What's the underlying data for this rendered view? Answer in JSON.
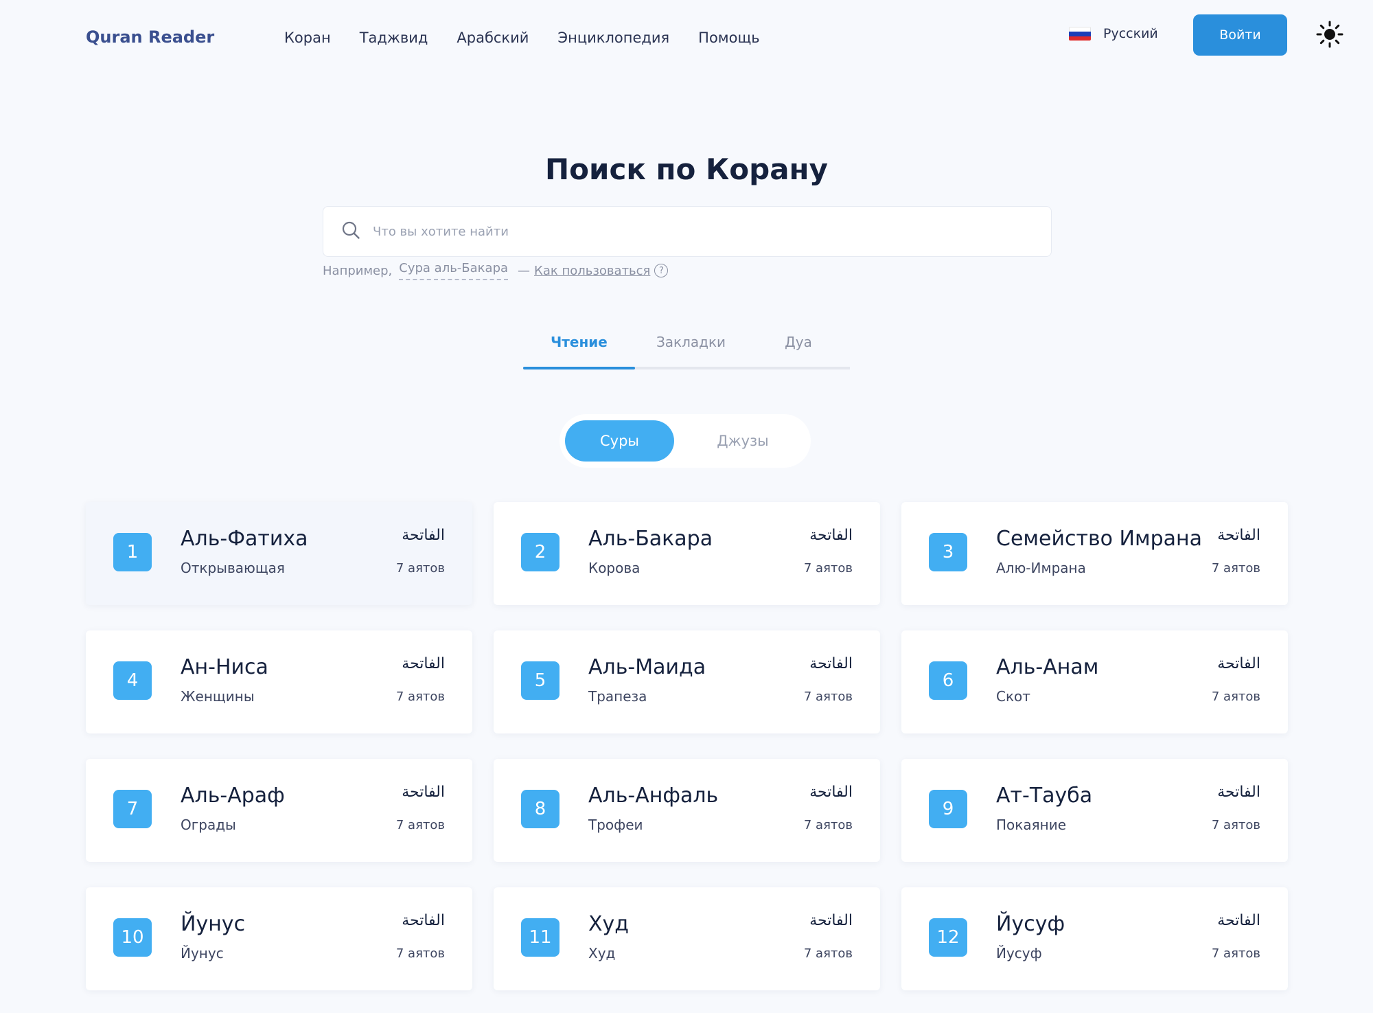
{
  "header": {
    "logo": "Quran Reader",
    "nav": [
      "Коран",
      "Таджвид",
      "Арабский",
      "Энциклопедия",
      "Помощь"
    ],
    "language": "Русский",
    "login": "Войти",
    "theme_icon": "sun-icon"
  },
  "search": {
    "title": "Поиск по Корану",
    "placeholder": "Что вы хотите найти",
    "hint_prefix": "Например,",
    "hint_example": "Сура аль-Бакара",
    "hint_sep": "—",
    "hint_howto": "Как пользоваться",
    "help_glyph": "?"
  },
  "tabs": [
    "Чтение",
    "Закладки",
    "Дуа"
  ],
  "segment": {
    "active": "Суры",
    "inactive": "Джузы"
  },
  "colors": {
    "accent": "#2a8fdc",
    "badge": "#42aef2",
    "background": "#f7f9fd"
  },
  "surahs": [
    {
      "num": "1",
      "name": "Аль-Фатиха",
      "translation": "Открывающая",
      "arabic": "الفاتحة",
      "ayat": "7 аятов"
    },
    {
      "num": "2",
      "name": "Аль-Бакара",
      "translation": "Корова",
      "arabic": "الفاتحة",
      "ayat": "7 аятов"
    },
    {
      "num": "3",
      "name": "Семейство Имрана",
      "translation": "Алю-Имрана",
      "arabic": "الفاتحة",
      "ayat": "7 аятов"
    },
    {
      "num": "4",
      "name": "Ан-Ниса",
      "translation": "Женщины",
      "arabic": "الفاتحة",
      "ayat": "7 аятов"
    },
    {
      "num": "5",
      "name": "Аль-Маида",
      "translation": "Трапеза",
      "arabic": "الفاتحة",
      "ayat": "7 аятов"
    },
    {
      "num": "6",
      "name": "Аль-Анам",
      "translation": "Скот",
      "arabic": "الفاتحة",
      "ayat": "7 аятов"
    },
    {
      "num": "7",
      "name": "Аль-Араф",
      "translation": "Ограды",
      "arabic": "الفاتحة",
      "ayat": "7 аятов"
    },
    {
      "num": "8",
      "name": "Аль-Анфаль",
      "translation": "Трофеи",
      "arabic": "الفاتحة",
      "ayat": "7 аятов"
    },
    {
      "num": "9",
      "name": "Ат-Тауба",
      "translation": "Покаяние",
      "arabic": "الفاتحة",
      "ayat": "7 аятов"
    },
    {
      "num": "10",
      "name": "Йунус",
      "translation": "Йунус",
      "arabic": "الفاتحة",
      "ayat": "7 аятов"
    },
    {
      "num": "11",
      "name": "Худ",
      "translation": "Худ",
      "arabic": "الفاتحة",
      "ayat": "7 аятов"
    },
    {
      "num": "12",
      "name": "Йусуф",
      "translation": "Йусуф",
      "arabic": "الفاتحة",
      "ayat": "7 аятов"
    }
  ]
}
